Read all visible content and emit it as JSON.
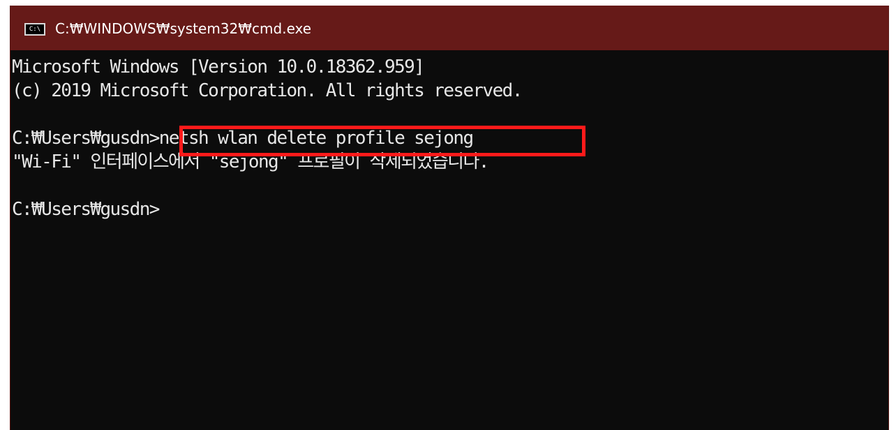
{
  "window": {
    "title": "C:₩WINDOWS₩system32₩cmd.exe",
    "icon_label": "C:\\",
    "icon": "command-prompt-icon"
  },
  "console": {
    "lines": [
      "Microsoft Windows [Version 10.0.18362.959]",
      "(c) 2019 Microsoft Corporation. All rights reserved.",
      "",
      "C:₩Users₩gusdn>netsh wlan delete profile sejong",
      "\"Wi-Fi\" 인터페이스에서 \"sejong\" 프로필이 삭제되었습니다.",
      "",
      "C:₩Users₩gusdn>"
    ]
  },
  "colors": {
    "titlebar": "#661a18",
    "console_bg": "#0c0c0c",
    "console_text": "#e6e6e6",
    "highlight": "#ff1a1a"
  }
}
